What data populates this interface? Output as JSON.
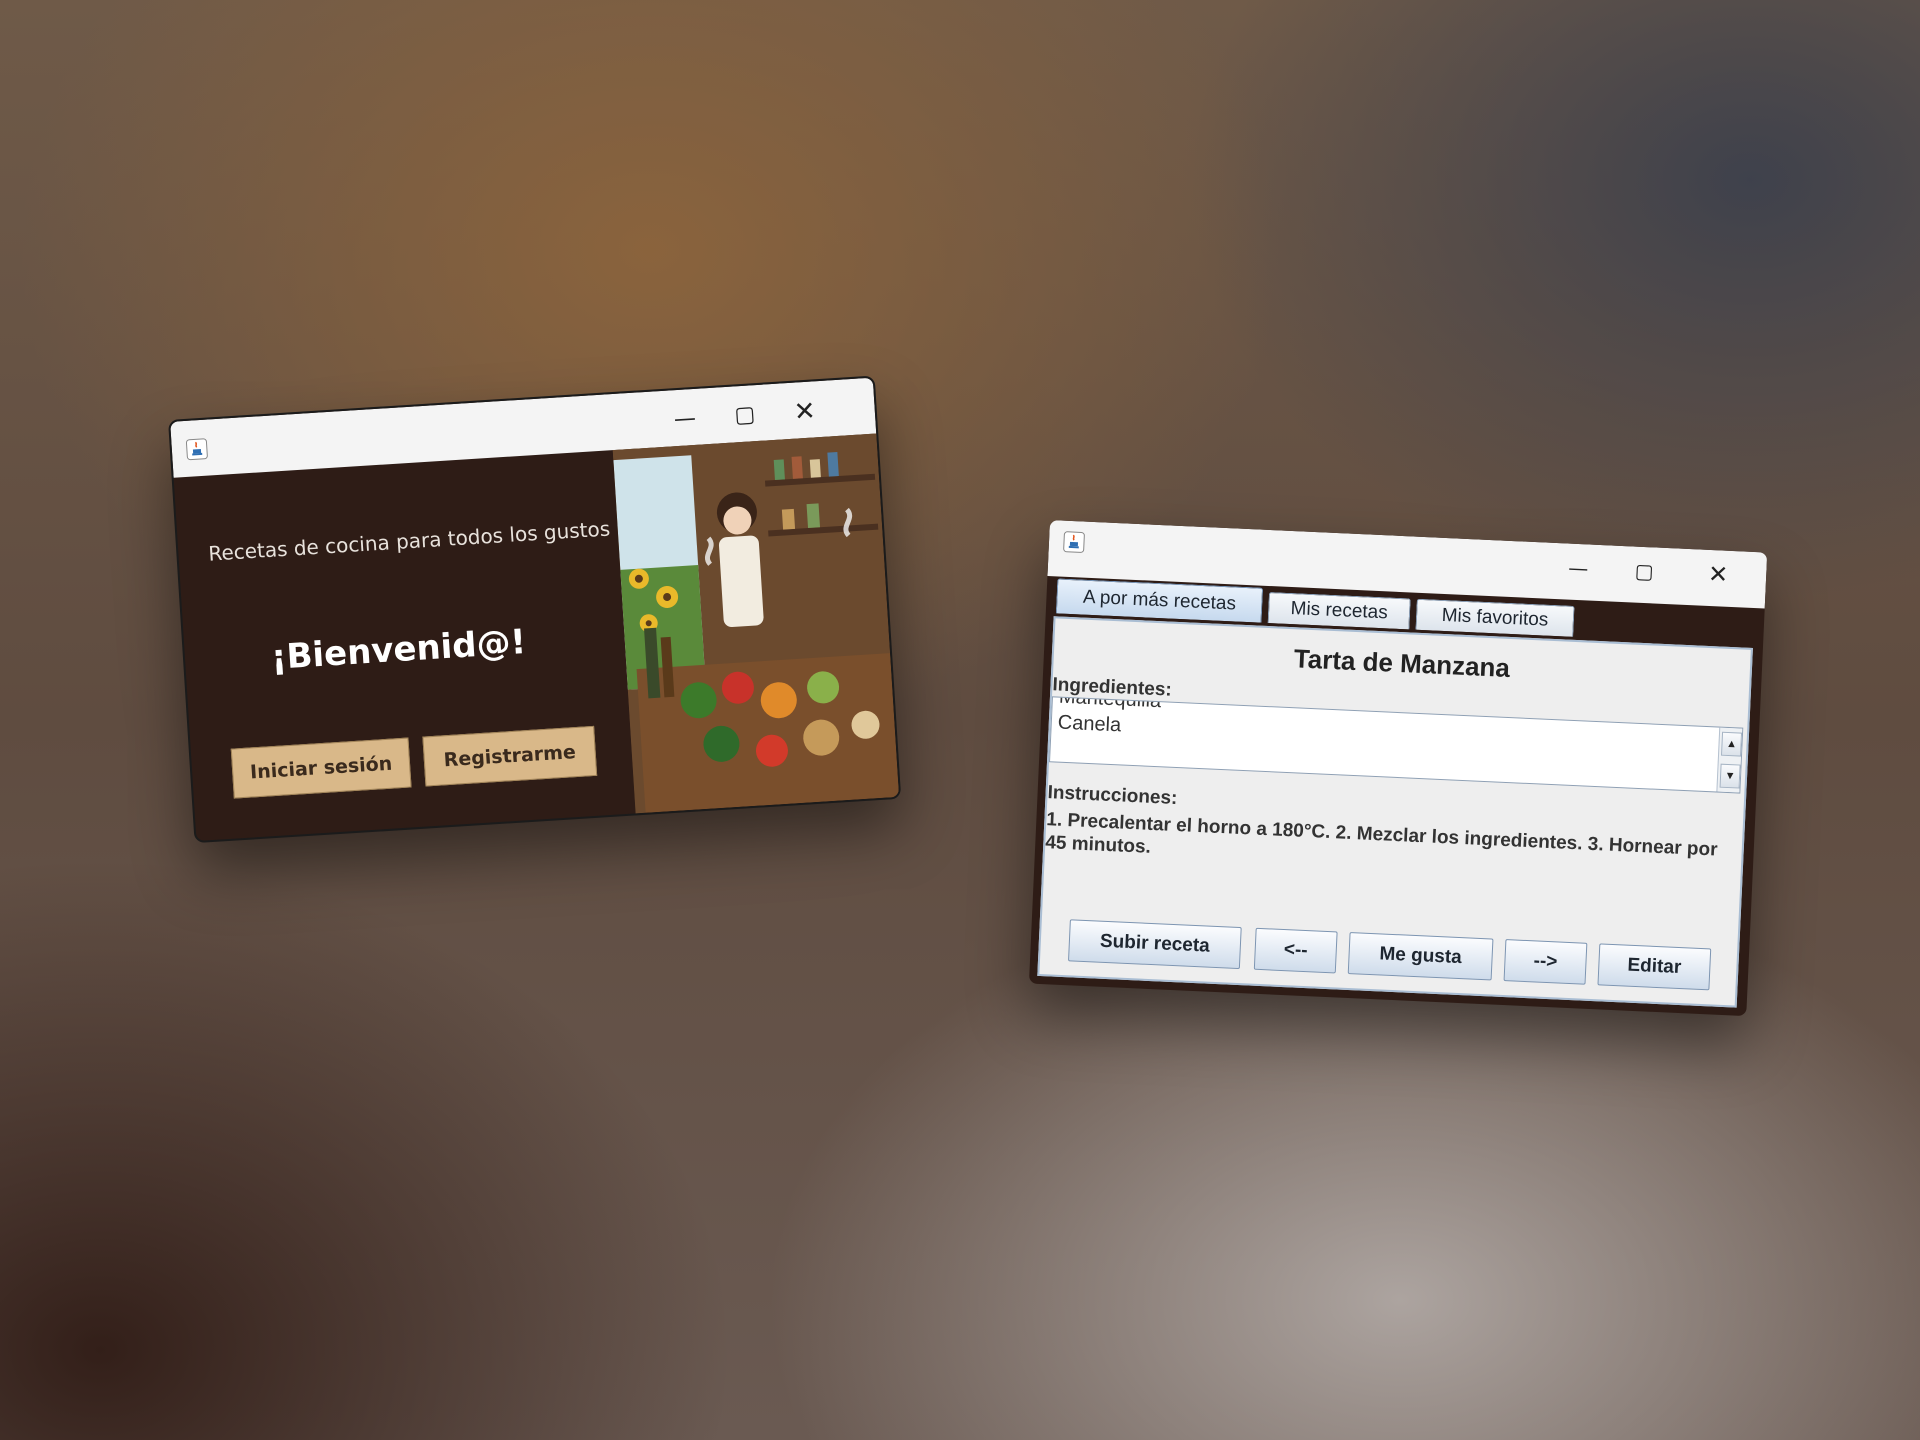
{
  "welcome_window": {
    "subtitle": "Recetas de cocina para todos los gustos",
    "heading": "¡Bienvenid@!",
    "login_button": "Iniciar sesión",
    "register_button": "Registrarme"
  },
  "recipes_window": {
    "tabs": [
      {
        "label": "A por más recetas",
        "active": true
      },
      {
        "label": "Mis recetas",
        "active": false
      },
      {
        "label": "Mis favoritos",
        "active": false
      }
    ],
    "recipe_title": "Tarta de Manzana",
    "ingredients_label": "Ingredientes:",
    "ingredients": [
      "Mantequilla",
      "Canela"
    ],
    "instructions_label": "Instrucciones:",
    "instructions_text": "1. Precalentar el horno a 180°C. 2. Mezclar los ingredientes. 3. Hornear por 45 minutos.",
    "buttons": {
      "upload": "Subir receta",
      "prev": "<--",
      "like": "Me gusta",
      "next": "-->",
      "edit": "Editar"
    }
  },
  "colors": {
    "window_bg": "#2e1c16",
    "tan_button": "#d9b889",
    "tab_active": "#c6d9ee"
  }
}
